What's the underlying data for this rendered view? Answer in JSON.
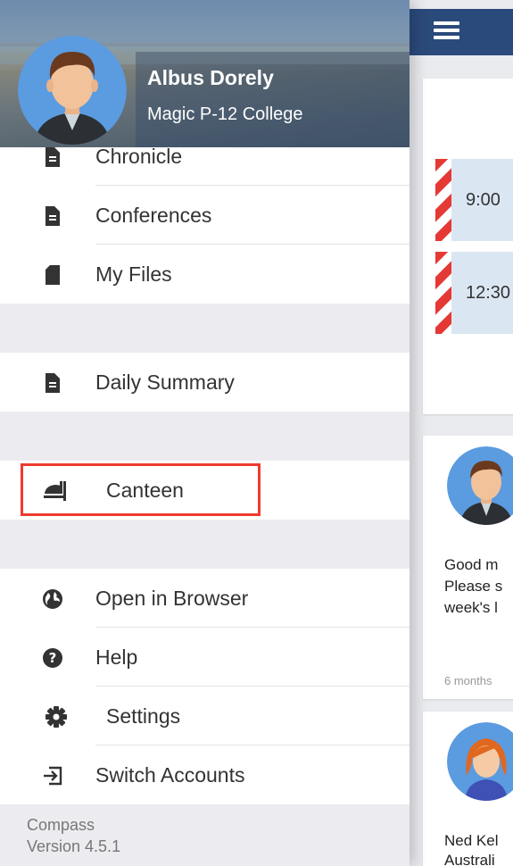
{
  "user": {
    "name": "Albus Dorely",
    "school": "Magic P-12 College"
  },
  "menu": {
    "section1": [
      {
        "label": "Chronicle",
        "icon": "document-icon"
      },
      {
        "label": "Conferences",
        "icon": "document-icon"
      },
      {
        "label": "My Files",
        "icon": "sd-card-icon"
      }
    ],
    "section2": [
      {
        "label": "Daily Summary",
        "icon": "document-icon"
      }
    ],
    "section3": [
      {
        "label": "Canteen",
        "icon": "canteen-icon"
      }
    ],
    "section4": [
      {
        "label": "Open in Browser",
        "icon": "globe-icon"
      },
      {
        "label": "Help",
        "icon": "help-icon"
      },
      {
        "label": "Settings",
        "icon": "gear-icon"
      },
      {
        "label": "Switch Accounts",
        "icon": "switch-account-icon"
      }
    ]
  },
  "footer": {
    "app_name": "Compass",
    "version": "Version 4.5.1"
  },
  "main": {
    "events": [
      {
        "time": "9:00"
      },
      {
        "time": "12:30"
      }
    ],
    "posts": [
      {
        "lines": [
          "Good m",
          "Please s",
          "week's l"
        ],
        "timestamp": "6 months"
      },
      {
        "lines": [
          "Ned Kel",
          "Australi"
        ]
      }
    ]
  },
  "colors": {
    "app_bar": "#2b4a7c",
    "highlight": "#ee3b2e",
    "event_bg": "#dbe6f3",
    "event_stripe": "#e53935"
  }
}
